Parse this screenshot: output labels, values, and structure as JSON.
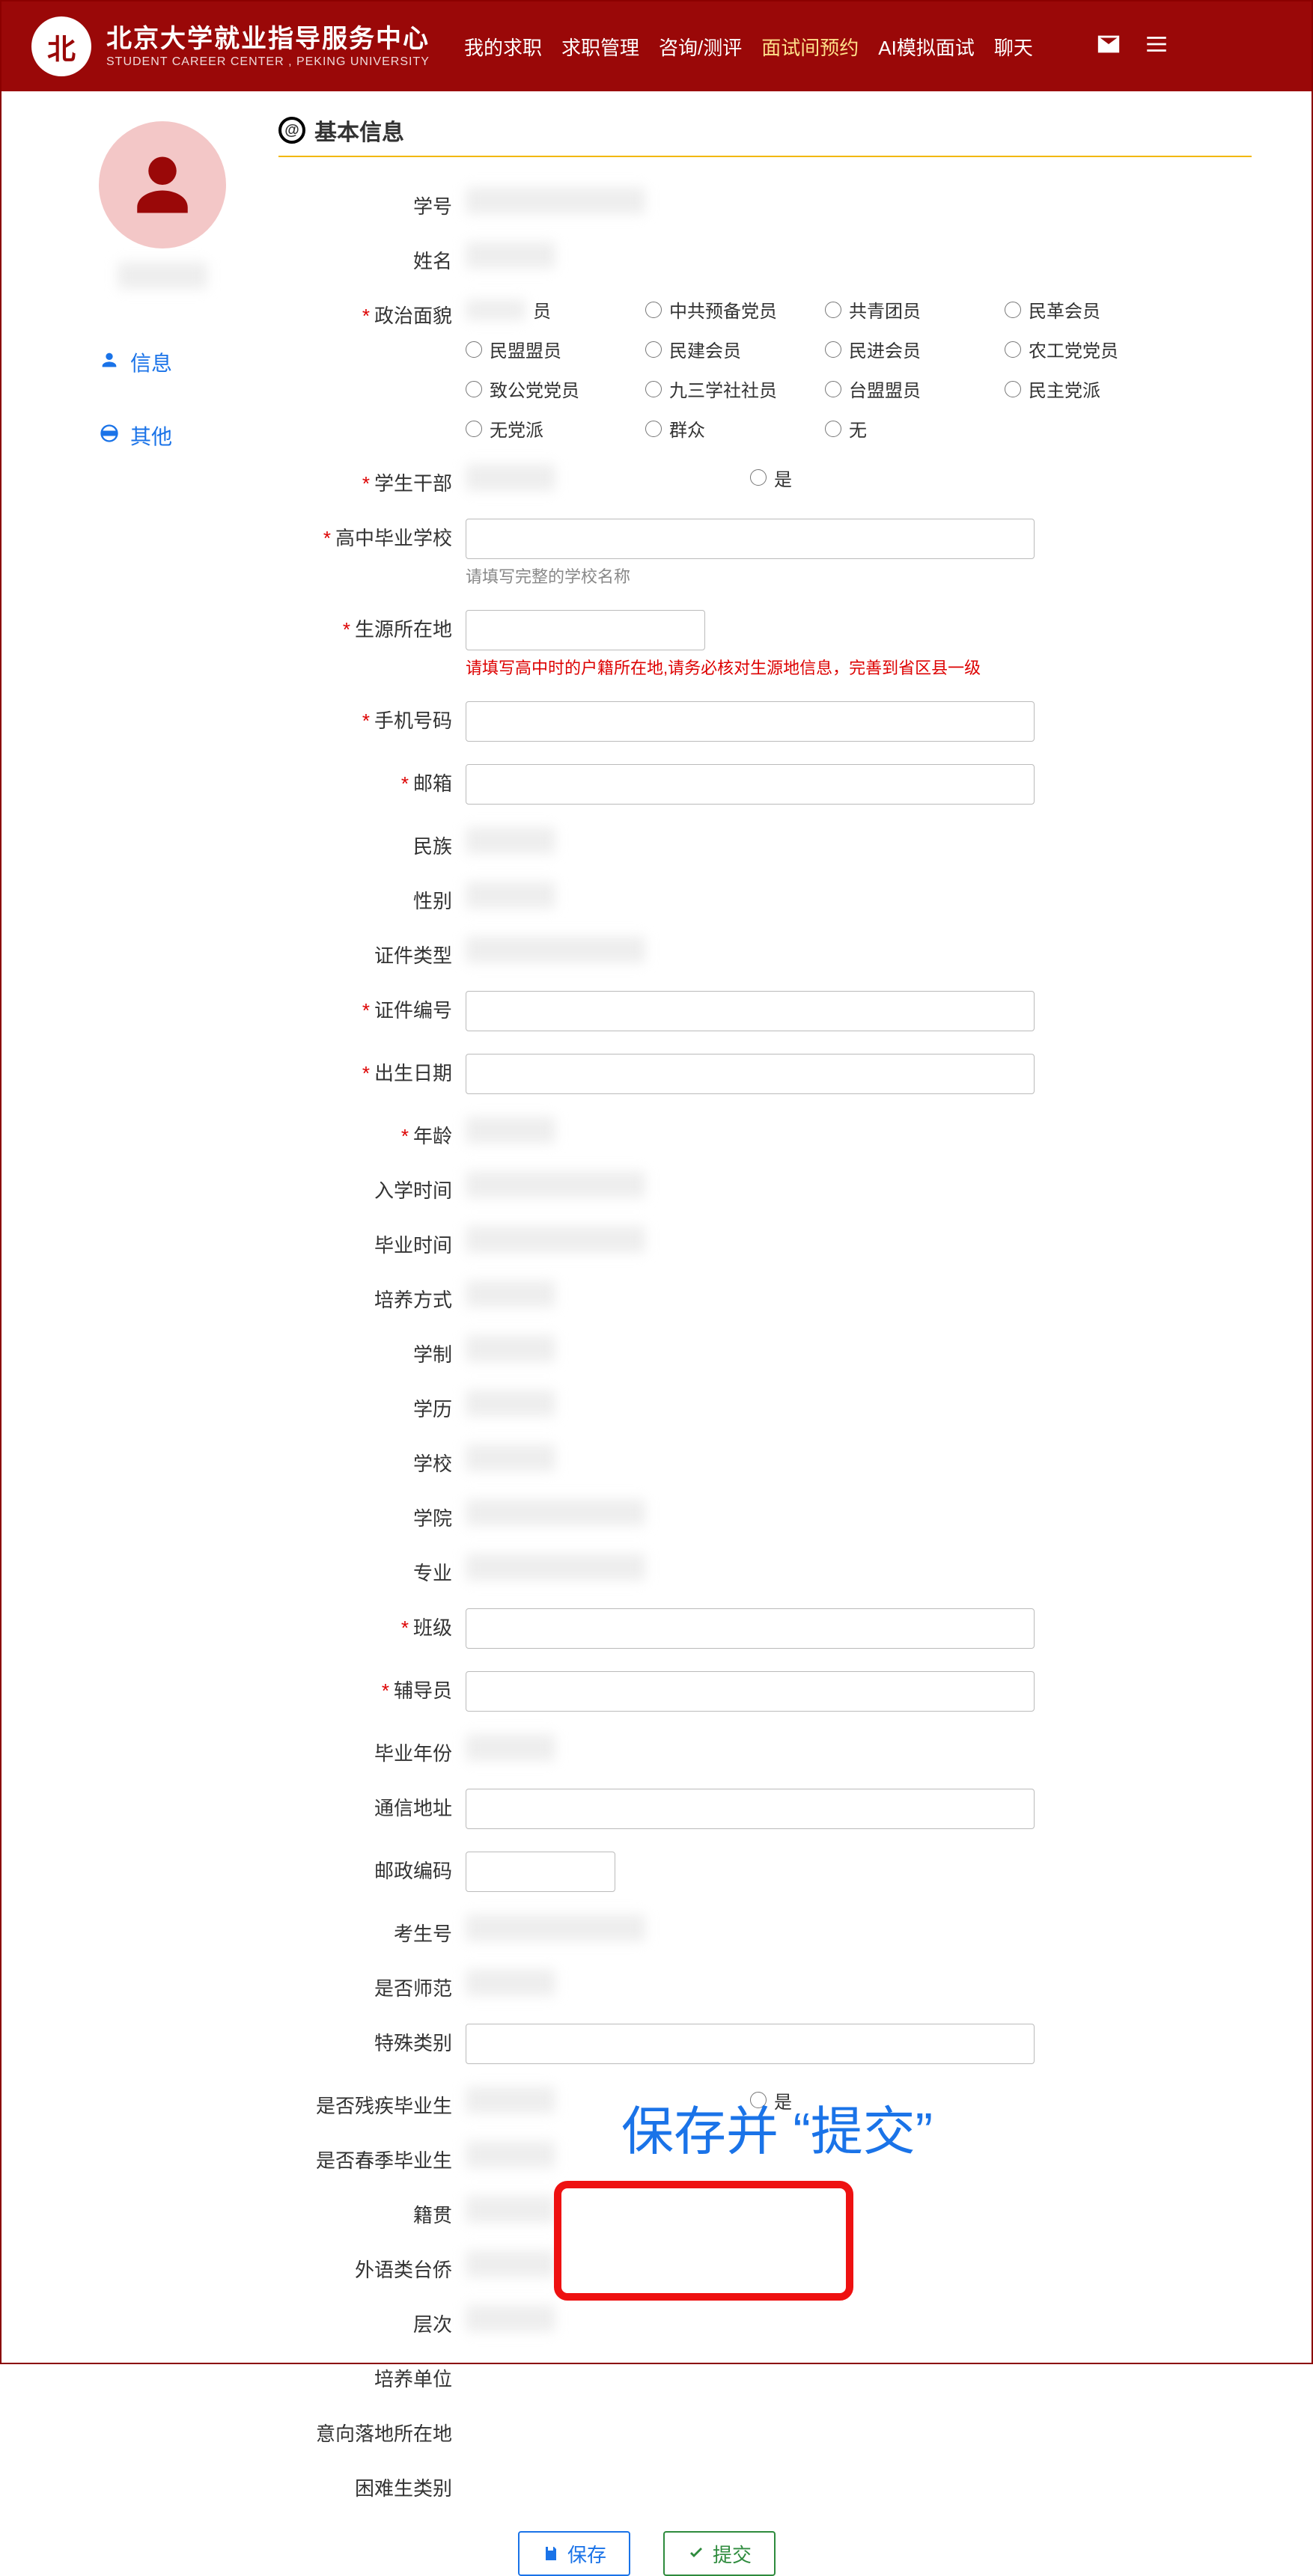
{
  "header": {
    "brand_cn": "北京大学就业指导服务中心",
    "brand_en": "STUDENT CAREER CENTER , PEKING UNIVERSITY",
    "nav": [
      "我的求职",
      "求职管理",
      "咨询/测评",
      "面试间预约",
      "AI模拟面试",
      "聊天"
    ],
    "nav_active_index": 3
  },
  "sidebar": {
    "items": [
      {
        "label": "信息"
      },
      {
        "label": "其他"
      }
    ]
  },
  "section_title": "基本信息",
  "form": {
    "student_id": {
      "label": "学号"
    },
    "name": {
      "label": "姓名"
    },
    "political": {
      "label": "政治面貌",
      "first_suffix": "员",
      "options": [
        "中共预备党员",
        "共青团员",
        "民革会员",
        "民盟盟员",
        "民建会员",
        "民进会员",
        "农工党党员",
        "致公党党员",
        "九三学社社员",
        "台盟盟员",
        "民主党派",
        "无党派",
        "群众",
        "无"
      ]
    },
    "cadre": {
      "label": "学生干部",
      "yes": "是"
    },
    "highschool": {
      "label": "高中毕业学校",
      "hint": "请填写完整的学校名称"
    },
    "origin": {
      "label": "生源所在地",
      "hint": "请填写高中时的户籍所在地,请务必核对生源地信息，完善到省区县一级"
    },
    "phone": {
      "label": "手机号码"
    },
    "email": {
      "label": "邮箱"
    },
    "ethnic": {
      "label": "民族"
    },
    "gender": {
      "label": "性别"
    },
    "id_type": {
      "label": "证件类型"
    },
    "id_no": {
      "label": "证件编号"
    },
    "birth": {
      "label": "出生日期"
    },
    "age": {
      "label": "年龄"
    },
    "enroll": {
      "label": "入学时间"
    },
    "grad_time": {
      "label": "毕业时间"
    },
    "culture": {
      "label": "培养方式"
    },
    "system": {
      "label": "学制"
    },
    "degree": {
      "label": "学历"
    },
    "school": {
      "label": "学校"
    },
    "college": {
      "label": "学院"
    },
    "major": {
      "label": "专业"
    },
    "class": {
      "label": "班级"
    },
    "advisor": {
      "label": "辅导员"
    },
    "grad_year": {
      "label": "毕业年份"
    },
    "address": {
      "label": "通信地址"
    },
    "postcode": {
      "label": "邮政编码"
    },
    "exam_no": {
      "label": "考生号"
    },
    "normal": {
      "label": "是否师范"
    },
    "special": {
      "label": "特殊类别"
    },
    "disability": {
      "label": "是否残疾毕业生",
      "yes": "是"
    },
    "spring": {
      "label": "是否春季毕业生"
    },
    "native": {
      "label": "籍贯"
    },
    "overseas": {
      "label": "外语类台侨"
    },
    "level": {
      "label": "层次"
    },
    "train_unit": {
      "label": "培养单位"
    },
    "target_loc": {
      "label": "意向落地所在地"
    },
    "diff_type": {
      "label": "困难生类别"
    }
  },
  "buttons": {
    "save": "保存",
    "submit": "提交"
  },
  "annotation": "保存并 “提交”"
}
